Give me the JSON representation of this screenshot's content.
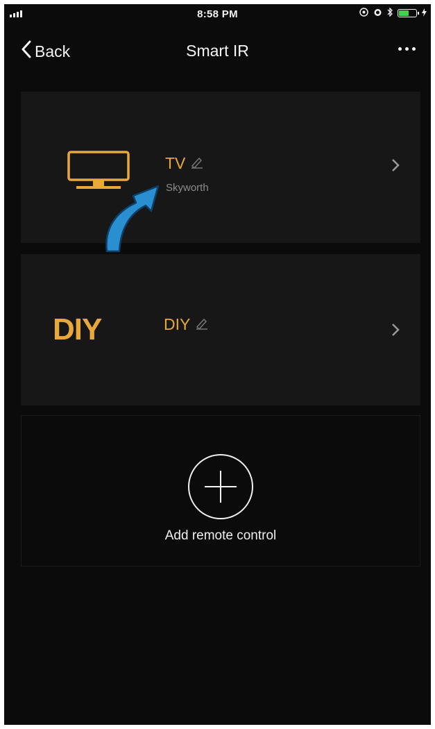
{
  "status_bar": {
    "time": "8:58 PM",
    "icons": [
      "signal-icon",
      "location-icon",
      "alarm-icon",
      "bluetooth-icon",
      "battery-icon",
      "charging-icon"
    ],
    "battery_color": "#3ed34a"
  },
  "nav": {
    "back_label": "Back",
    "title": "Smart IR",
    "more_icon": "more-dots-icon"
  },
  "remotes": [
    {
      "icon": "tv-icon",
      "name": "TV",
      "brand": "Skyworth",
      "edit_icon": "edit-pencil-icon",
      "chevron_icon": "chevron-right-icon"
    },
    {
      "icon_text": "DIY",
      "name": "DIY",
      "edit_icon": "edit-pencil-icon",
      "chevron_icon": "chevron-right-icon"
    }
  ],
  "add_remote": {
    "icon": "plus-circle-icon",
    "label": "Add remote control"
  },
  "annotation": {
    "icon": "blue-pointer-arrow-icon",
    "color": "#2a8fd0"
  },
  "colors": {
    "background": "#0b0b0b",
    "card": "#171717",
    "accent": "#e8a93a",
    "text": "#f5f5f5",
    "muted": "#8c8c8c"
  }
}
